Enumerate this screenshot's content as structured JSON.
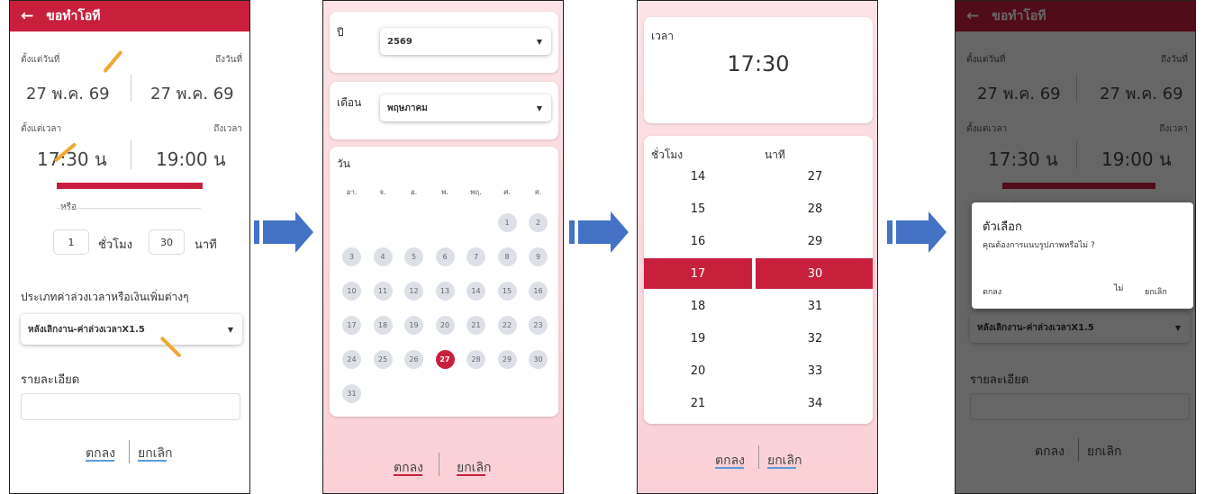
{
  "form": {
    "header_title": "ขอทำโอที",
    "from_date_label": "ตั้งแต่วันที่",
    "to_date_label": "ถึงวันที่",
    "from_date": "27 พ.ค. 69",
    "to_date": "27 พ.ค. 69",
    "from_time_label": "ตั้งแต่เวลา",
    "to_time_label": "ถึงเวลา",
    "from_time": "17:30 น",
    "to_time": "19:00 น",
    "or_label": "หรือ",
    "hours_value": "1",
    "hours_label": "ชั่วโมง",
    "minutes_value": "30",
    "minutes_label": "นาที",
    "type_label": "ประเภทค่าล่วงเวลาหรือเงินเพิ่มต่างๆ",
    "type_value": "หลังเลิกงาน-ค่าล่วงเวลาX1.5",
    "detail_label": "รายละเอียด",
    "ok_label": "ตกลง",
    "cancel_label": "ยกเลิก"
  },
  "date_picker": {
    "year_label": "ปี",
    "year_value": "2569",
    "month_label": "เดือน",
    "month_value": "พฤษภาคม",
    "day_label": "วัน",
    "weekdays": [
      "อา.",
      "จ.",
      "อ.",
      "พ.",
      "พฤ.",
      "ศ.",
      "ส."
    ],
    "days": [
      "1",
      "2",
      "3",
      "4",
      "5",
      "6",
      "7",
      "8",
      "9",
      "10",
      "11",
      "12",
      "13",
      "14",
      "15",
      "16",
      "17",
      "18",
      "19",
      "20",
      "21",
      "22",
      "23",
      "24",
      "25",
      "26",
      "27",
      "28",
      "29",
      "30",
      "31"
    ],
    "selected_day": "27",
    "ok_label": "ตกลง",
    "cancel_label": "ยกเลิก"
  },
  "time_picker": {
    "time_label": "เวลา",
    "time_value": "17:30",
    "hour_label": "ชั่วโมง",
    "minute_label": "นาที",
    "hours": [
      "14",
      "15",
      "16",
      "17",
      "18",
      "19",
      "20",
      "21"
    ],
    "minutes": [
      "27",
      "28",
      "29",
      "30",
      "31",
      "32",
      "33",
      "34"
    ],
    "selected_hour": "17",
    "selected_minute": "30",
    "ok_label": "ตกลง",
    "cancel_label": "ยกเลิก"
  },
  "dialog": {
    "title": "ตัวเลือก",
    "message": "คุณต้องการแนบรูปภาพหรือไม่ ?",
    "ok_label": "ตกลง",
    "no_label": "ไม่",
    "cancel_label": "ยกเลิก"
  },
  "colors": {
    "accent": "#c8203c",
    "arrow": "#4472c4",
    "highlight": "#f0a830"
  }
}
